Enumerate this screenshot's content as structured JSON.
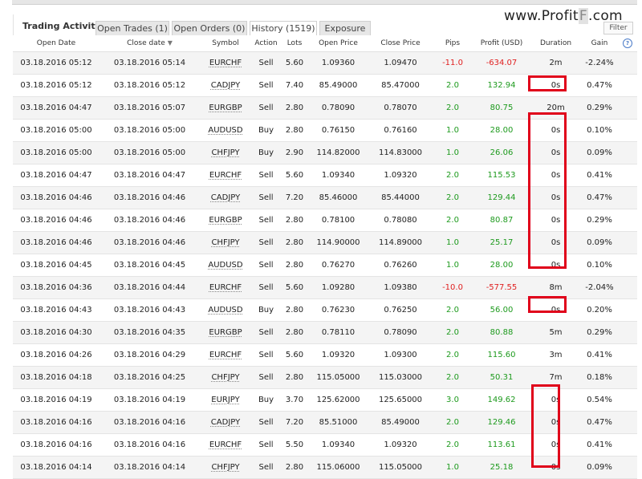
{
  "tabs": {
    "title": "Trading Activity",
    "items": [
      {
        "label": "Open Trades (1)"
      },
      {
        "label": "Open Orders (0)"
      },
      {
        "label": "History (1519)"
      },
      {
        "label": "Exposure"
      }
    ],
    "filter_label": "Filter"
  },
  "watermark": {
    "part1": "www.Profit",
    "part2": "F",
    "part3": ".com"
  },
  "columns": [
    "Open Date",
    "Close date",
    "Symbol",
    "Action",
    "Lots",
    "Open Price",
    "Close Price",
    "Pips",
    "Profit (USD)",
    "Duration",
    "Gain"
  ],
  "sort_icon": "sort-down-arrow",
  "help_icon": "question-circle",
  "colors": {
    "negative": "#e02020",
    "positive": "#1d9a1d",
    "highlight_box": "#e0001a"
  },
  "rows": [
    {
      "open_date": "03.18.2016 05:12",
      "close_date": "03.18.2016 05:14",
      "symbol": "EURCHF",
      "action": "Sell",
      "lots": "5.60",
      "open_price": "1.09360",
      "close_price": "1.09470",
      "pips": "-11.0",
      "profit": "-634.07",
      "duration": "2m",
      "gain": "-2.24%"
    },
    {
      "open_date": "03.18.2016 05:12",
      "close_date": "03.18.2016 05:12",
      "symbol": "CADJPY",
      "action": "Sell",
      "lots": "7.40",
      "open_price": "85.49000",
      "close_price": "85.47000",
      "pips": "2.0",
      "profit": "132.94",
      "duration": "0s",
      "gain": "0.47%"
    },
    {
      "open_date": "03.18.2016 04:47",
      "close_date": "03.18.2016 05:07",
      "symbol": "EURGBP",
      "action": "Sell",
      "lots": "2.80",
      "open_price": "0.78090",
      "close_price": "0.78070",
      "pips": "2.0",
      "profit": "80.75",
      "duration": "20m",
      "gain": "0.29%"
    },
    {
      "open_date": "03.18.2016 05:00",
      "close_date": "03.18.2016 05:00",
      "symbol": "AUDUSD",
      "action": "Buy",
      "lots": "2.80",
      "open_price": "0.76150",
      "close_price": "0.76160",
      "pips": "1.0",
      "profit": "28.00",
      "duration": "0s",
      "gain": "0.10%"
    },
    {
      "open_date": "03.18.2016 05:00",
      "close_date": "03.18.2016 05:00",
      "symbol": "CHFJPY",
      "action": "Buy",
      "lots": "2.90",
      "open_price": "114.82000",
      "close_price": "114.83000",
      "pips": "1.0",
      "profit": "26.06",
      "duration": "0s",
      "gain": "0.09%"
    },
    {
      "open_date": "03.18.2016 04:47",
      "close_date": "03.18.2016 04:47",
      "symbol": "EURCHF",
      "action": "Sell",
      "lots": "5.60",
      "open_price": "1.09340",
      "close_price": "1.09320",
      "pips": "2.0",
      "profit": "115.53",
      "duration": "0s",
      "gain": "0.41%"
    },
    {
      "open_date": "03.18.2016 04:46",
      "close_date": "03.18.2016 04:46",
      "symbol": "CADJPY",
      "action": "Sell",
      "lots": "7.20",
      "open_price": "85.46000",
      "close_price": "85.44000",
      "pips": "2.0",
      "profit": "129.44",
      "duration": "0s",
      "gain": "0.47%"
    },
    {
      "open_date": "03.18.2016 04:46",
      "close_date": "03.18.2016 04:46",
      "symbol": "EURGBP",
      "action": "Sell",
      "lots": "2.80",
      "open_price": "0.78100",
      "close_price": "0.78080",
      "pips": "2.0",
      "profit": "80.87",
      "duration": "0s",
      "gain": "0.29%"
    },
    {
      "open_date": "03.18.2016 04:46",
      "close_date": "03.18.2016 04:46",
      "symbol": "CHFJPY",
      "action": "Sell",
      "lots": "2.80",
      "open_price": "114.90000",
      "close_price": "114.89000",
      "pips": "1.0",
      "profit": "25.17",
      "duration": "0s",
      "gain": "0.09%"
    },
    {
      "open_date": "03.18.2016 04:45",
      "close_date": "03.18.2016 04:45",
      "symbol": "AUDUSD",
      "action": "Sell",
      "lots": "2.80",
      "open_price": "0.76270",
      "close_price": "0.76260",
      "pips": "1.0",
      "profit": "28.00",
      "duration": "0s",
      "gain": "0.10%"
    },
    {
      "open_date": "03.18.2016 04:36",
      "close_date": "03.18.2016 04:44",
      "symbol": "EURCHF",
      "action": "Sell",
      "lots": "5.60",
      "open_price": "1.09280",
      "close_price": "1.09380",
      "pips": "-10.0",
      "profit": "-577.55",
      "duration": "8m",
      "gain": "-2.04%"
    },
    {
      "open_date": "03.18.2016 04:43",
      "close_date": "03.18.2016 04:43",
      "symbol": "AUDUSD",
      "action": "Buy",
      "lots": "2.80",
      "open_price": "0.76230",
      "close_price": "0.76250",
      "pips": "2.0",
      "profit": "56.00",
      "duration": "0s",
      "gain": "0.20%"
    },
    {
      "open_date": "03.18.2016 04:30",
      "close_date": "03.18.2016 04:35",
      "symbol": "EURGBP",
      "action": "Sell",
      "lots": "2.80",
      "open_price": "0.78110",
      "close_price": "0.78090",
      "pips": "2.0",
      "profit": "80.88",
      "duration": "5m",
      "gain": "0.29%"
    },
    {
      "open_date": "03.18.2016 04:26",
      "close_date": "03.18.2016 04:29",
      "symbol": "EURCHF",
      "action": "Sell",
      "lots": "5.60",
      "open_price": "1.09320",
      "close_price": "1.09300",
      "pips": "2.0",
      "profit": "115.60",
      "duration": "3m",
      "gain": "0.41%"
    },
    {
      "open_date": "03.18.2016 04:18",
      "close_date": "03.18.2016 04:25",
      "symbol": "CHFJPY",
      "action": "Sell",
      "lots": "2.80",
      "open_price": "115.05000",
      "close_price": "115.03000",
      "pips": "2.0",
      "profit": "50.31",
      "duration": "7m",
      "gain": "0.18%"
    },
    {
      "open_date": "03.18.2016 04:19",
      "close_date": "03.18.2016 04:19",
      "symbol": "EURJPY",
      "action": "Buy",
      "lots": "3.70",
      "open_price": "125.62000",
      "close_price": "125.65000",
      "pips": "3.0",
      "profit": "149.62",
      "duration": "0s",
      "gain": "0.54%"
    },
    {
      "open_date": "03.18.2016 04:16",
      "close_date": "03.18.2016 04:16",
      "symbol": "CADJPY",
      "action": "Sell",
      "lots": "7.20",
      "open_price": "85.51000",
      "close_price": "85.49000",
      "pips": "2.0",
      "profit": "129.46",
      "duration": "0s",
      "gain": "0.47%"
    },
    {
      "open_date": "03.18.2016 04:16",
      "close_date": "03.18.2016 04:16",
      "symbol": "EURCHF",
      "action": "Sell",
      "lots": "5.50",
      "open_price": "1.09340",
      "close_price": "1.09320",
      "pips": "2.0",
      "profit": "113.61",
      "duration": "0s",
      "gain": "0.41%"
    },
    {
      "open_date": "03.18.2016 04:14",
      "close_date": "03.18.2016 04:14",
      "symbol": "CHFJPY",
      "action": "Sell",
      "lots": "2.80",
      "open_price": "115.06000",
      "close_price": "115.05000",
      "pips": "1.0",
      "profit": "25.18",
      "duration": "0s",
      "gain": "0.09%"
    }
  ]
}
